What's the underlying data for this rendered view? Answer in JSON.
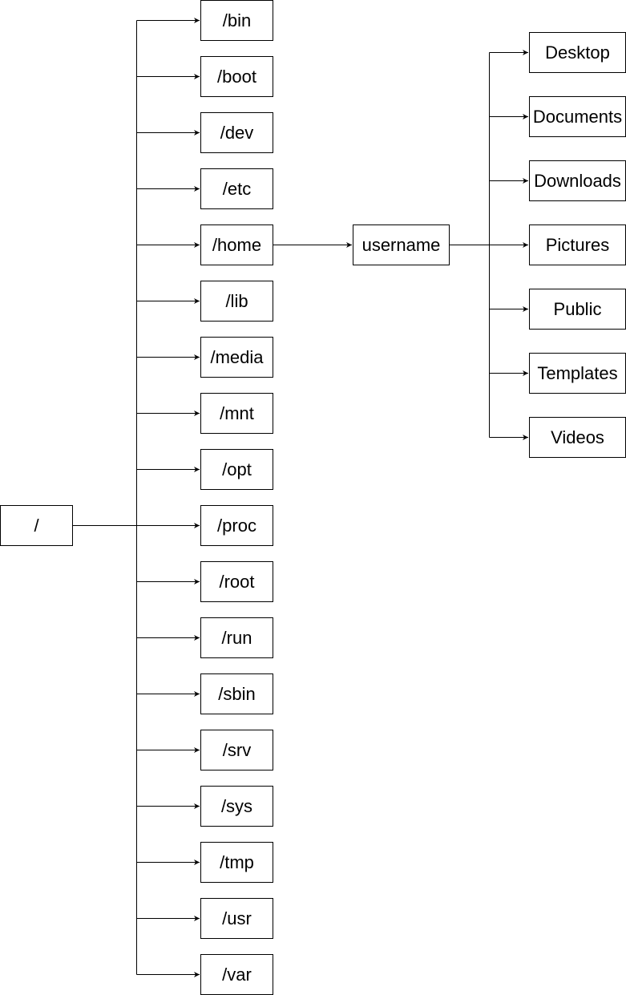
{
  "diagram": {
    "root": {
      "label": "/"
    },
    "root_children": [
      "/bin",
      "/boot",
      "/dev",
      "/etc",
      "/home",
      "/lib",
      "/media",
      "/mnt",
      "/opt",
      "/proc",
      "/root",
      "/run",
      "/sbin",
      "/srv",
      "/sys",
      "/tmp",
      "/usr",
      "/var"
    ],
    "home_child": {
      "label": "username",
      "parent": "/home"
    },
    "user_children": [
      "Desktop",
      "Documents",
      "Downloads",
      "Pictures",
      "Public",
      "Templates",
      "Videos"
    ],
    "colors": {
      "line": "#000000",
      "box_border": "#000000",
      "background": "#ffffff"
    }
  }
}
